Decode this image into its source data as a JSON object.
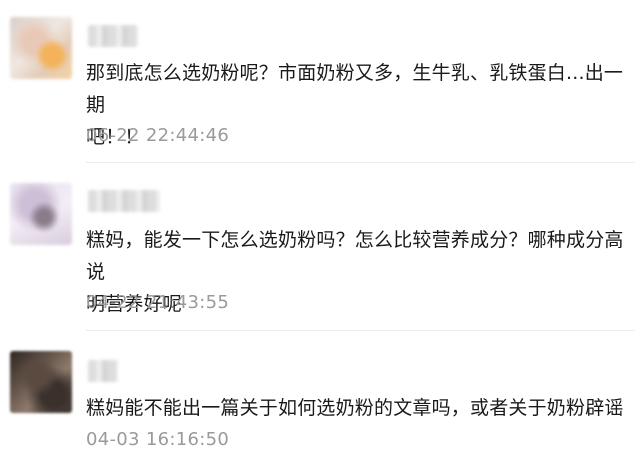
{
  "comments": [
    {
      "content": "那到底怎么选奶粉呢？市面奶粉又多，生牛乳、乳铁蛋白...出一期\n吧！！",
      "time": "06-22 22:44:46"
    },
    {
      "content": "糕妈，能发一下怎么选奶粉吗？怎么比较营养成分？哪种成分高说\n明营养好呢",
      "time": "04-22 21:43:55"
    },
    {
      "content": "糕妈能不能出一篇关于如何选奶粉的文章吗，或者关于奶粉辟谣",
      "time": "04-03 16:16:50"
    }
  ]
}
